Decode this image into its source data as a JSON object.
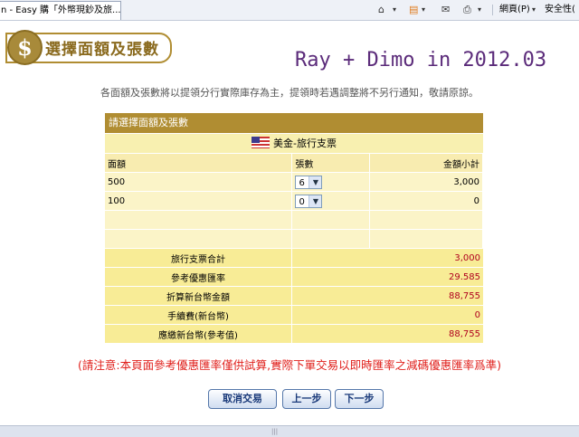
{
  "browser": {
    "tab_title": "n - Easy 購「外幣現鈔及旅...",
    "page_menu": "網頁(P)",
    "safety_menu": "安全性("
  },
  "header": {
    "icon": "$",
    "title": "選擇面額及張數",
    "annotation": "Ray + Dimo in 2012.03"
  },
  "notice": "各面額及張數將以提領分行實際庫存為主，提領時若遇調整將不另行通知，敬請原諒。",
  "form": {
    "section_title": "請選擇面額及張數",
    "currency_name": "美金-旅行支票",
    "columns": [
      "面額",
      "張數",
      "金額小計"
    ],
    "rows": [
      {
        "denomination": "500",
        "count": "6",
        "subtotal": "3,000"
      },
      {
        "denomination": "100",
        "count": "0",
        "subtotal": "0"
      }
    ],
    "summary": [
      {
        "label": "旅行支票合計",
        "value": "3,000"
      },
      {
        "label": "參考優惠匯率",
        "value": "29.585"
      },
      {
        "label": "折算新台幣金額",
        "value": "88,755"
      },
      {
        "label": "手續費(新台幣)",
        "value": "0"
      },
      {
        "label": "應繳新台幣(參考值)",
        "value": "88,755"
      }
    ]
  },
  "warning": "(請注意:本頁面參考優惠匯率僅供試算,實際下單交易以即時匯率之減碼優惠匯率爲準)",
  "buttons": {
    "cancel": "取消交易",
    "prev": "上一步",
    "next": "下一步"
  },
  "colors": {
    "gold": "#b08d32",
    "warning_red": "#e0201c",
    "value_red": "#b0001e"
  }
}
